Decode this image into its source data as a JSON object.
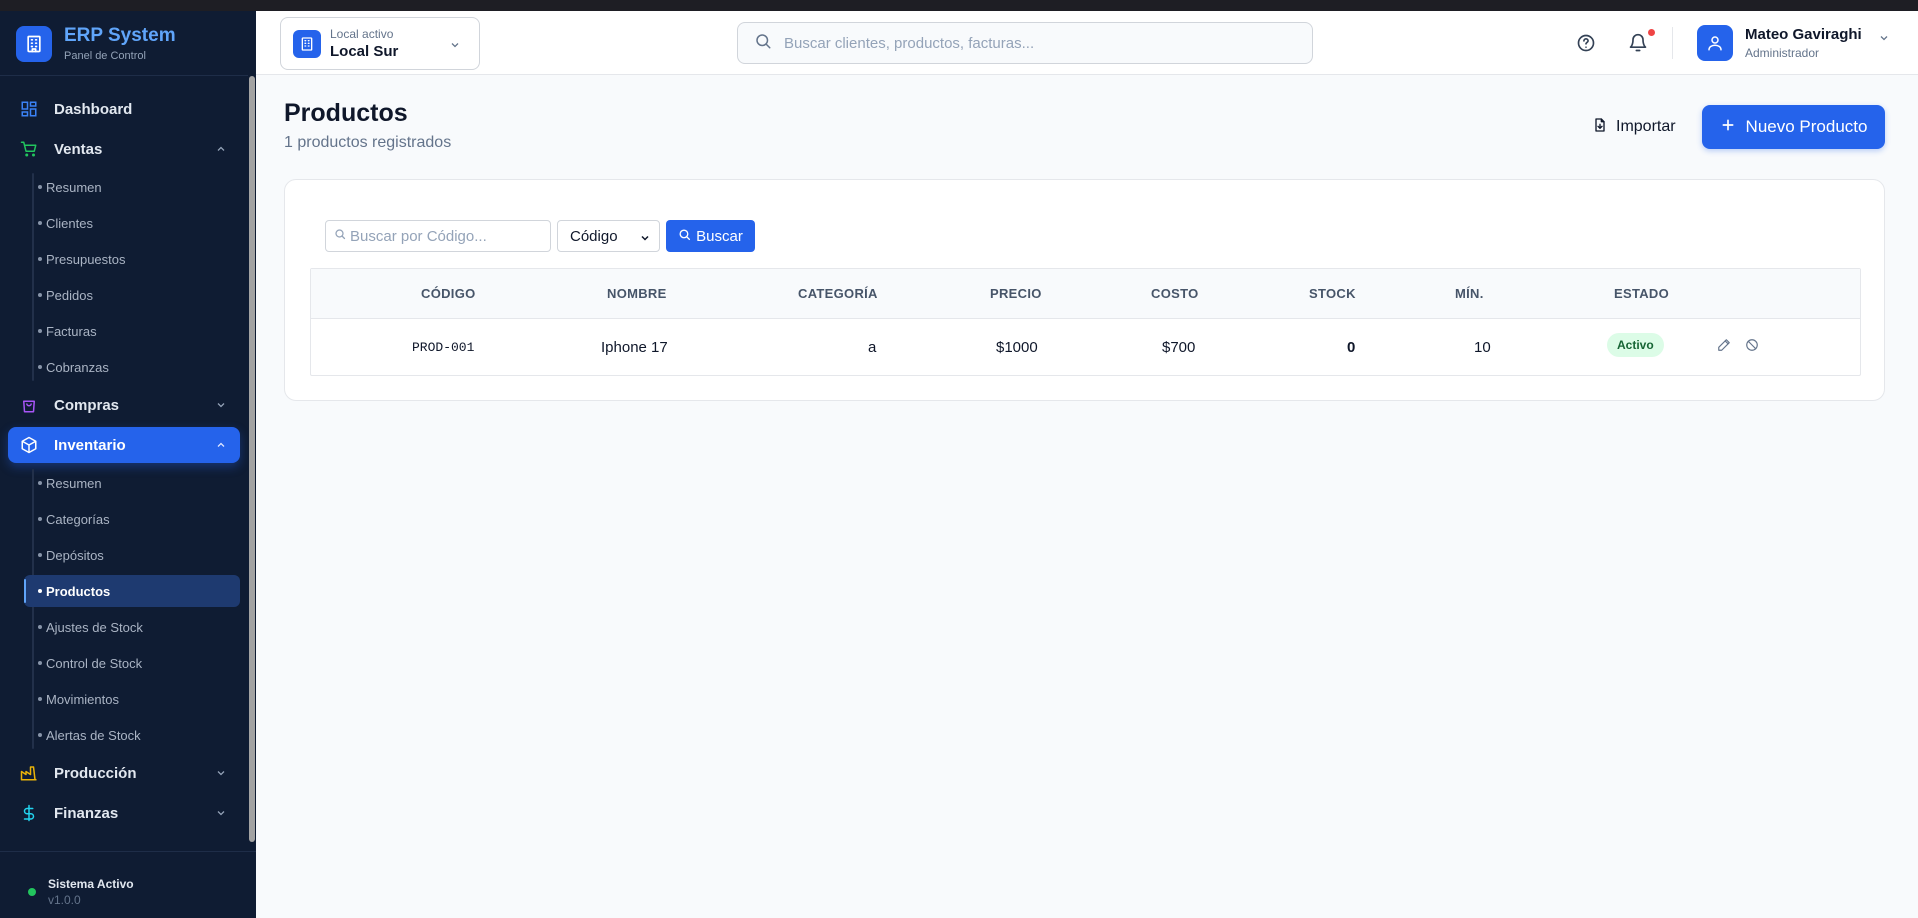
{
  "brand": {
    "title": "ERP System",
    "subtitle": "Panel de Control"
  },
  "sidebar": {
    "items": [
      {
        "label": "Dashboard",
        "icon": "dashboard-grid-icon",
        "color": "#3b82f6"
      },
      {
        "label": "Ventas",
        "icon": "cart-icon",
        "color": "#22c55e",
        "expanded": true,
        "children": [
          "Resumen",
          "Clientes",
          "Presupuestos",
          "Pedidos",
          "Facturas",
          "Cobranzas"
        ]
      },
      {
        "label": "Compras",
        "icon": "bag-icon",
        "color": "#a855f7",
        "expanded": false
      },
      {
        "label": "Inventario",
        "icon": "box-icon",
        "color": "#ffffff",
        "expanded": true,
        "active": true,
        "children": [
          "Resumen",
          "Categorías",
          "Depósitos",
          "Productos",
          "Ajustes de Stock",
          "Control de Stock",
          "Movimientos",
          "Alertas de Stock"
        ],
        "active_child": "Productos"
      },
      {
        "label": "Producción",
        "icon": "factory-icon",
        "color": "#eab308",
        "expanded": false
      },
      {
        "label": "Finanzas",
        "icon": "dollar-icon",
        "color": "#22d3ee",
        "expanded": false
      }
    ]
  },
  "system": {
    "status": "Sistema Activo",
    "version": "v1.0.0"
  },
  "header": {
    "local_caption": "Local activo",
    "local_value": "Local Sur",
    "search_placeholder": "Buscar clientes, productos, facturas...",
    "user_name": "Mateo Gaviraghi",
    "user_role": "Administrador"
  },
  "page": {
    "title": "Productos",
    "subtitle": "1 productos registrados",
    "import_label": "Importar",
    "new_label": "Nuevo Producto"
  },
  "filters": {
    "search_placeholder": "Buscar por Código...",
    "field_selected": "Código",
    "search_button": "Buscar"
  },
  "table": {
    "columns": [
      "CÓDIGO",
      "NOMBRE",
      "CATEGORÍA",
      "PRECIO",
      "COSTO",
      "STOCK",
      "MÍN.",
      "ESTADO"
    ],
    "rows": [
      {
        "codigo": "PROD-001",
        "nombre": "Iphone 17",
        "categoria": "a",
        "precio": "$1000",
        "costo": "$700",
        "stock": "0",
        "min": "10",
        "estado": "Activo"
      }
    ]
  },
  "colors": {
    "accent": "#2563eb",
    "sidebar_bg": "#0f1c33",
    "active_badge_bg": "#dcfce7"
  }
}
